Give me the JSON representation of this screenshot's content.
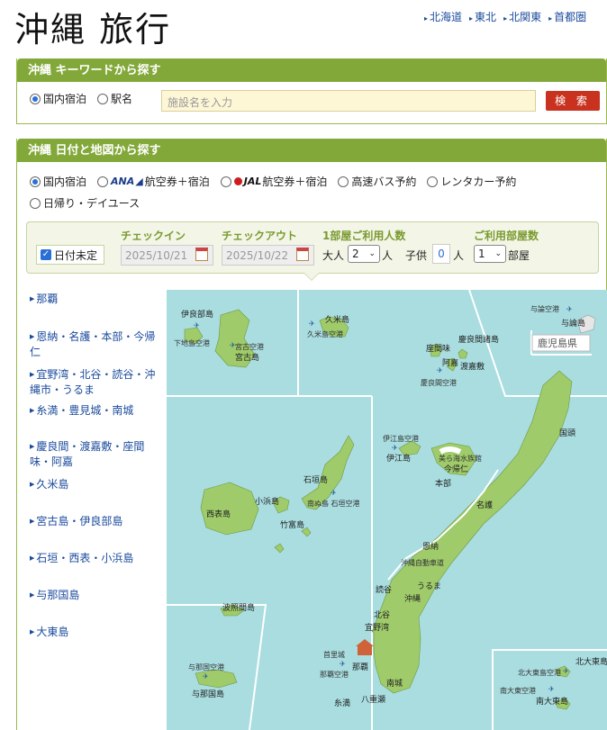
{
  "page": {
    "title": "沖縄 旅行"
  },
  "region_nav": [
    {
      "label": "北海道"
    },
    {
      "label": "東北"
    },
    {
      "label": "北関東"
    },
    {
      "label": "首都圏"
    }
  ],
  "keyword_panel": {
    "heading": "沖縄 キーワードから探す",
    "options": [
      {
        "label": "国内宿泊",
        "selected": true
      },
      {
        "label": "駅名",
        "selected": false
      }
    ],
    "input_placeholder": "施設名を入力",
    "search_label": "検 索"
  },
  "date_panel": {
    "heading": "沖縄 日付と地図から探す",
    "options_row1": [
      {
        "label": "国内宿泊",
        "selected": true
      },
      {
        "prefix": "ANA",
        "label": "航空券＋宿泊",
        "selected": false
      },
      {
        "prefix": "JAL",
        "label": "航空券＋宿泊",
        "selected": false
      },
      {
        "label": "高速バス予約",
        "selected": false
      },
      {
        "label": "レンタカー予約",
        "selected": false
      }
    ],
    "options_row2": [
      {
        "label": "日帰り・デイユース",
        "selected": false
      }
    ],
    "checkin_label": "チェックイン",
    "checkout_label": "チェックアウト",
    "guests_label": "1部屋ご利用人数",
    "rooms_label": "ご利用部屋数",
    "date_undecided": {
      "label": "日付未定",
      "checked": true
    },
    "checkin_value": "2025/10/21",
    "checkout_value": "2025/10/22",
    "adults_label": "大人",
    "adults_value": "2",
    "person_unit": "人",
    "children_label": "子供",
    "children_value": "0",
    "rooms_value": "1",
    "room_unit": "部屋"
  },
  "area_links": [
    {
      "label": "那覇"
    },
    {
      "label": "恩納・名護・本部・今帰仁"
    },
    {
      "label": "宜野湾・北谷・読谷・沖縄市・うるま"
    },
    {
      "label": "糸満・豊見城・南城"
    },
    {
      "label": "慶良間・渡嘉敷・座間味・阿嘉"
    },
    {
      "label": "久米島"
    },
    {
      "label": "宮古島・伊良部島"
    },
    {
      "label": "石垣・西表・小浜島"
    },
    {
      "label": "与那国島"
    },
    {
      "label": "大東島"
    }
  ],
  "map_labels": {
    "irabu": "伊良部島",
    "shimoji_airport": "下地島空港",
    "miyako_airport": "宮古空港",
    "miyako": "宮古島",
    "kume": "久米島",
    "kume_airport": "久米島空港",
    "yoron_airport": "与論空港",
    "yoron": "与論島",
    "kagoshima": "鹿児島県",
    "zamami": "座間味",
    "kerama": "慶良間諸島",
    "aka": "阿嘉",
    "tokashiki": "渡嘉敷",
    "kerama_airport": "慶良間空港",
    "kunigami": "国頭",
    "iejima_airport": "伊江島空港",
    "iejima": "伊江島",
    "aquarium": "美ら海水族館",
    "nakijin": "今帰仁",
    "motobu": "本部",
    "nago": "名護",
    "ishigaki": "石垣島",
    "kohama": "小浜島",
    "iriomote": "西表島",
    "taketomi": "竹富島",
    "ishigaki_airport": "南ぬ島 石垣空港",
    "onna": "恩納",
    "expressway": "沖縄自動車道",
    "uruma": "うるま",
    "yomitan": "読谷",
    "okinawa": "沖縄",
    "chatan": "北谷",
    "ginowan": "宜野湾",
    "hateruma": "波照間島",
    "yonaguni_airport": "与那国空港",
    "yonaguni": "与那国島",
    "shuri": "首里城",
    "naha_airport": "那覇空港",
    "naha": "那覇",
    "nanjo": "南城",
    "yaese": "八重瀬",
    "itoman": "糸満",
    "kitadaito": "北大東島",
    "kitadaito_airport": "北大東島空港",
    "minamidaito_airport": "南大東空港",
    "minamidaito": "南大東島"
  },
  "colors": {
    "accent": "#83a83a",
    "sea": "#a9dde0",
    "land": "#9fcb6a",
    "link": "#1a4a9c",
    "search_button": "#c8321e"
  }
}
